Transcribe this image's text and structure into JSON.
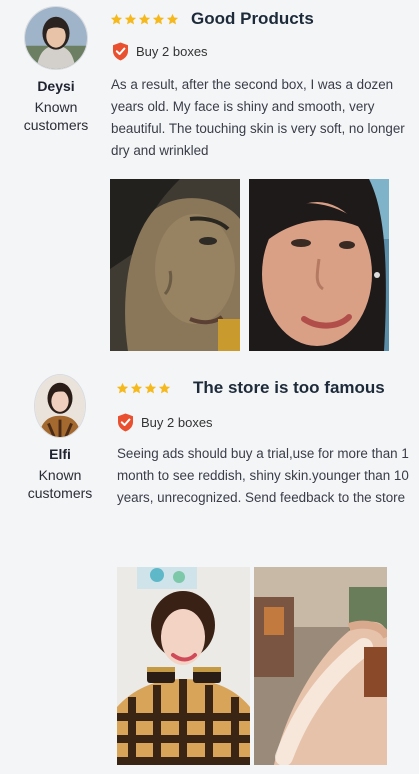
{
  "reviews": [
    {
      "author": {
        "name": "Deysi",
        "status": "Known customers"
      },
      "rating": 5,
      "title": "Good Products",
      "purchase": "Buy 2 boxes",
      "text": "As a result, after the second box, I was a dozen years old.  My face is shiny and smooth, very beautiful.  The touching skin is very soft, no longer dry and wrinkled"
    },
    {
      "author": {
        "name": "Elfi",
        "status": "Known customers"
      },
      "rating": 4,
      "title": "The store is too famous",
      "purchase": "Buy 2 boxes",
      "text": "Seeing ads should buy a trial,use for more than 1 month to see reddish, shiny skin.younger than 10 years, unrecognized.  Send feedback to the store"
    }
  ],
  "colors": {
    "star": "#f5b91e",
    "shield": "#e9502f",
    "title": "#1d2a3a"
  },
  "icons": {
    "star": "star-icon",
    "verified": "verified-shield-icon"
  }
}
